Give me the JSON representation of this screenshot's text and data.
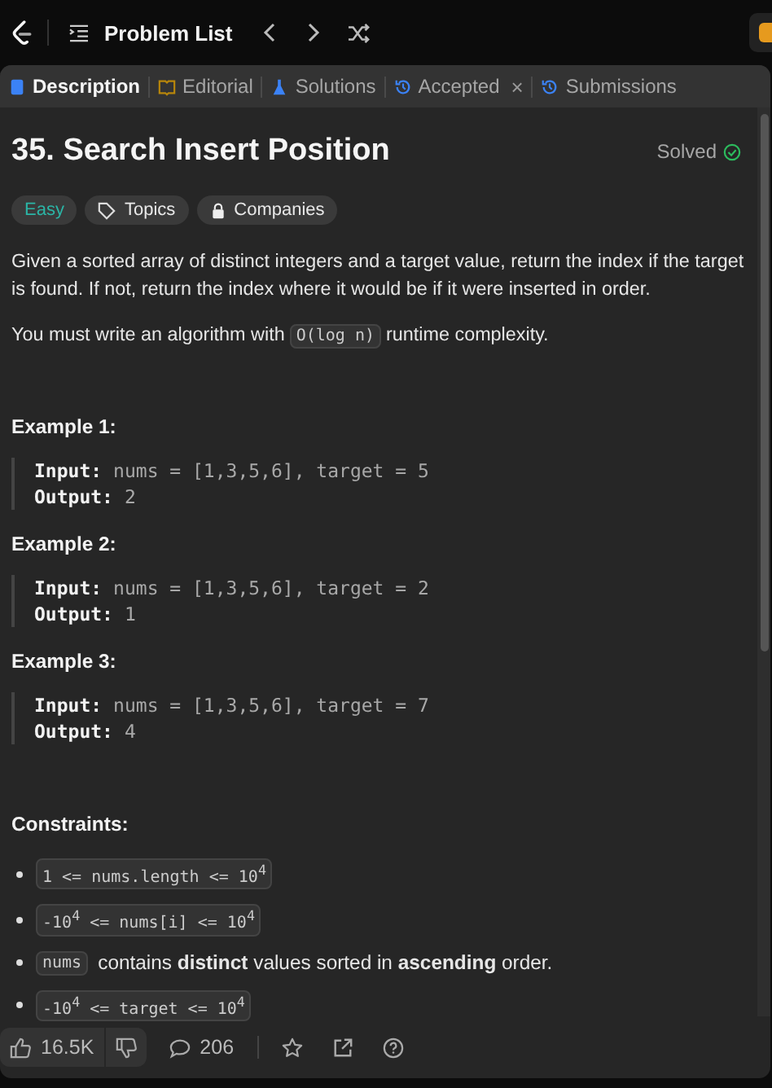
{
  "top_bar": {
    "problem_list": "Problem List"
  },
  "tabs": [
    {
      "label": "Description",
      "kind": "description",
      "selected": true
    },
    {
      "label": "Editorial",
      "kind": "editorial",
      "selected": false
    },
    {
      "label": "Solutions",
      "kind": "solutions",
      "selected": false
    },
    {
      "label": "Accepted",
      "kind": "accepted",
      "selected": false,
      "close": "×"
    },
    {
      "label": "Submissions",
      "kind": "submissions",
      "selected": false
    }
  ],
  "problem": {
    "title": "35. Search Insert Position",
    "status": "Solved",
    "difficulty": "Easy",
    "tags": [
      {
        "label": "Topics",
        "kind": "topics"
      },
      {
        "label": "Companies",
        "kind": "companies"
      }
    ]
  },
  "description": [
    "Given a sorted array of distinct integers and a target value, return the index if the target is found. If not, return the index where it would be if it were inserted in order."
  ],
  "complexity": {
    "before": "You must write an algorithm with",
    "code": "O(log n)",
    "after": "runtime complexity."
  },
  "examples": [
    {
      "title": "Example 1:",
      "input_label": "Input:",
      "input": "nums = [1,3,5,6], target = 5",
      "output_label": "Output:",
      "output": "2"
    },
    {
      "title": "Example 2:",
      "input_label": "Input:",
      "input": "nums = [1,3,5,6], target = 2",
      "output_label": "Output:",
      "output": "1"
    },
    {
      "title": "Example 3:",
      "input_label": "Input:",
      "input": "nums = [1,3,5,6], target = 7",
      "output_label": "Output:",
      "output": "4"
    }
  ],
  "constraints_title": "Constraints:",
  "constraints": [
    {
      "kind": "code",
      "code": "1 <= nums.length <= 10$^{4}$"
    },
    {
      "kind": "code",
      "code": "-10$^{4}$ <= nums[i] <= 10$^{4}$"
    },
    {
      "kind": "mixed",
      "code": "nums",
      "text": "contains **distinct** values sorted in **ascending** order."
    },
    {
      "kind": "code",
      "code": "-10$^{4}$ <= target <= 10$^{4}$"
    }
  ],
  "footer": {
    "likes": "16.5K",
    "comments": "206"
  }
}
